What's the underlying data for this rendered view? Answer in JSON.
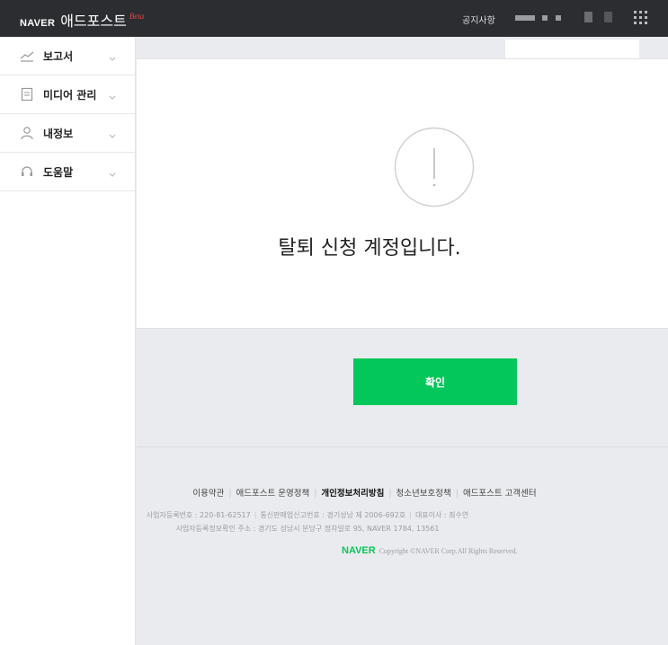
{
  "header": {
    "brand": "NAVER",
    "service_title": "애드포스트",
    "beta": "Beta",
    "notice_link": "공지사항"
  },
  "sidebar": {
    "items": [
      {
        "label": "보고서",
        "icon": "chart-line-icon"
      },
      {
        "label": "미디어 관리",
        "icon": "document-icon"
      },
      {
        "label": "내정보",
        "icon": "person-icon"
      },
      {
        "label": "도움말",
        "icon": "headset-icon"
      }
    ]
  },
  "main": {
    "message": "탈퇴 신청 계정입니다.",
    "confirm_label": "확인"
  },
  "footer": {
    "links": [
      "이용약관",
      "애드포스트 운영정책",
      "개인정보처리방침",
      "청소년보호정책",
      "애드포스트 고객센터"
    ],
    "info_line1": [
      "사업자등록번호 : 220-81-62517",
      "통신판매업신고번호 : 경기성남 제 2006-692호",
      "대표이사 : 최수연"
    ],
    "info_line2": "사업자등록정보확인 주소 : 경기도 성남시 분당구 정자일로 95, NAVER 1784, 13561",
    "copyright_brand": "NAVER",
    "copyright_text": "Copyright ©NAVER Corp.All Rights Reserved."
  },
  "colors": {
    "topbar": "#2b2d31",
    "accent_green": "#03c75a",
    "beta_red": "#e8453c",
    "page_bg": "#e9ebee"
  }
}
